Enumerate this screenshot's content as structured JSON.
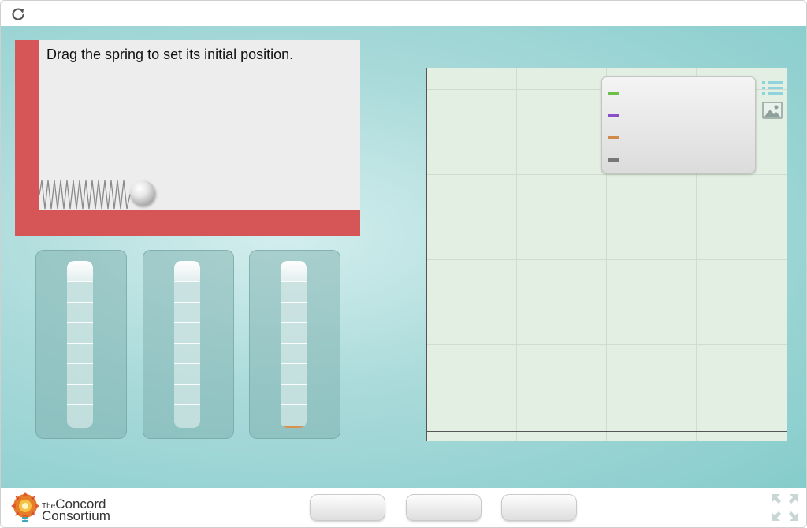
{
  "app": {
    "reload_icon": "reload-icon",
    "instruction": "Drag the spring to set its initial position."
  },
  "simulation": {
    "spring_icon": "spring",
    "ball_icon": "ball"
  },
  "bar_graphs": [
    {
      "fill_fraction": 0.0,
      "color": "#d8924e"
    },
    {
      "fill_fraction": 0.0,
      "color": "#d8924e"
    },
    {
      "fill_fraction": 0.01,
      "color": "#d8924e"
    }
  ],
  "graph": {
    "legend": [
      {
        "color": "#6cc04a",
        "label": ""
      },
      {
        "color": "#8a4fc8",
        "label": ""
      },
      {
        "color": "#d08a4a",
        "label": ""
      },
      {
        "color": "#777777",
        "label": ""
      }
    ],
    "list_icon": "list-icon",
    "image_icon": "image-icon"
  },
  "footer": {
    "logo_line1_small": "The",
    "logo_line1": "Concord",
    "logo_line2": "Consortium",
    "buttons": [
      {
        "label": ""
      },
      {
        "label": ""
      },
      {
        "label": ""
      }
    ],
    "fullscreen_icon": "fullscreen-icon"
  },
  "colors": {
    "wall": "#d65657",
    "accent_teal": "#86cccc"
  }
}
